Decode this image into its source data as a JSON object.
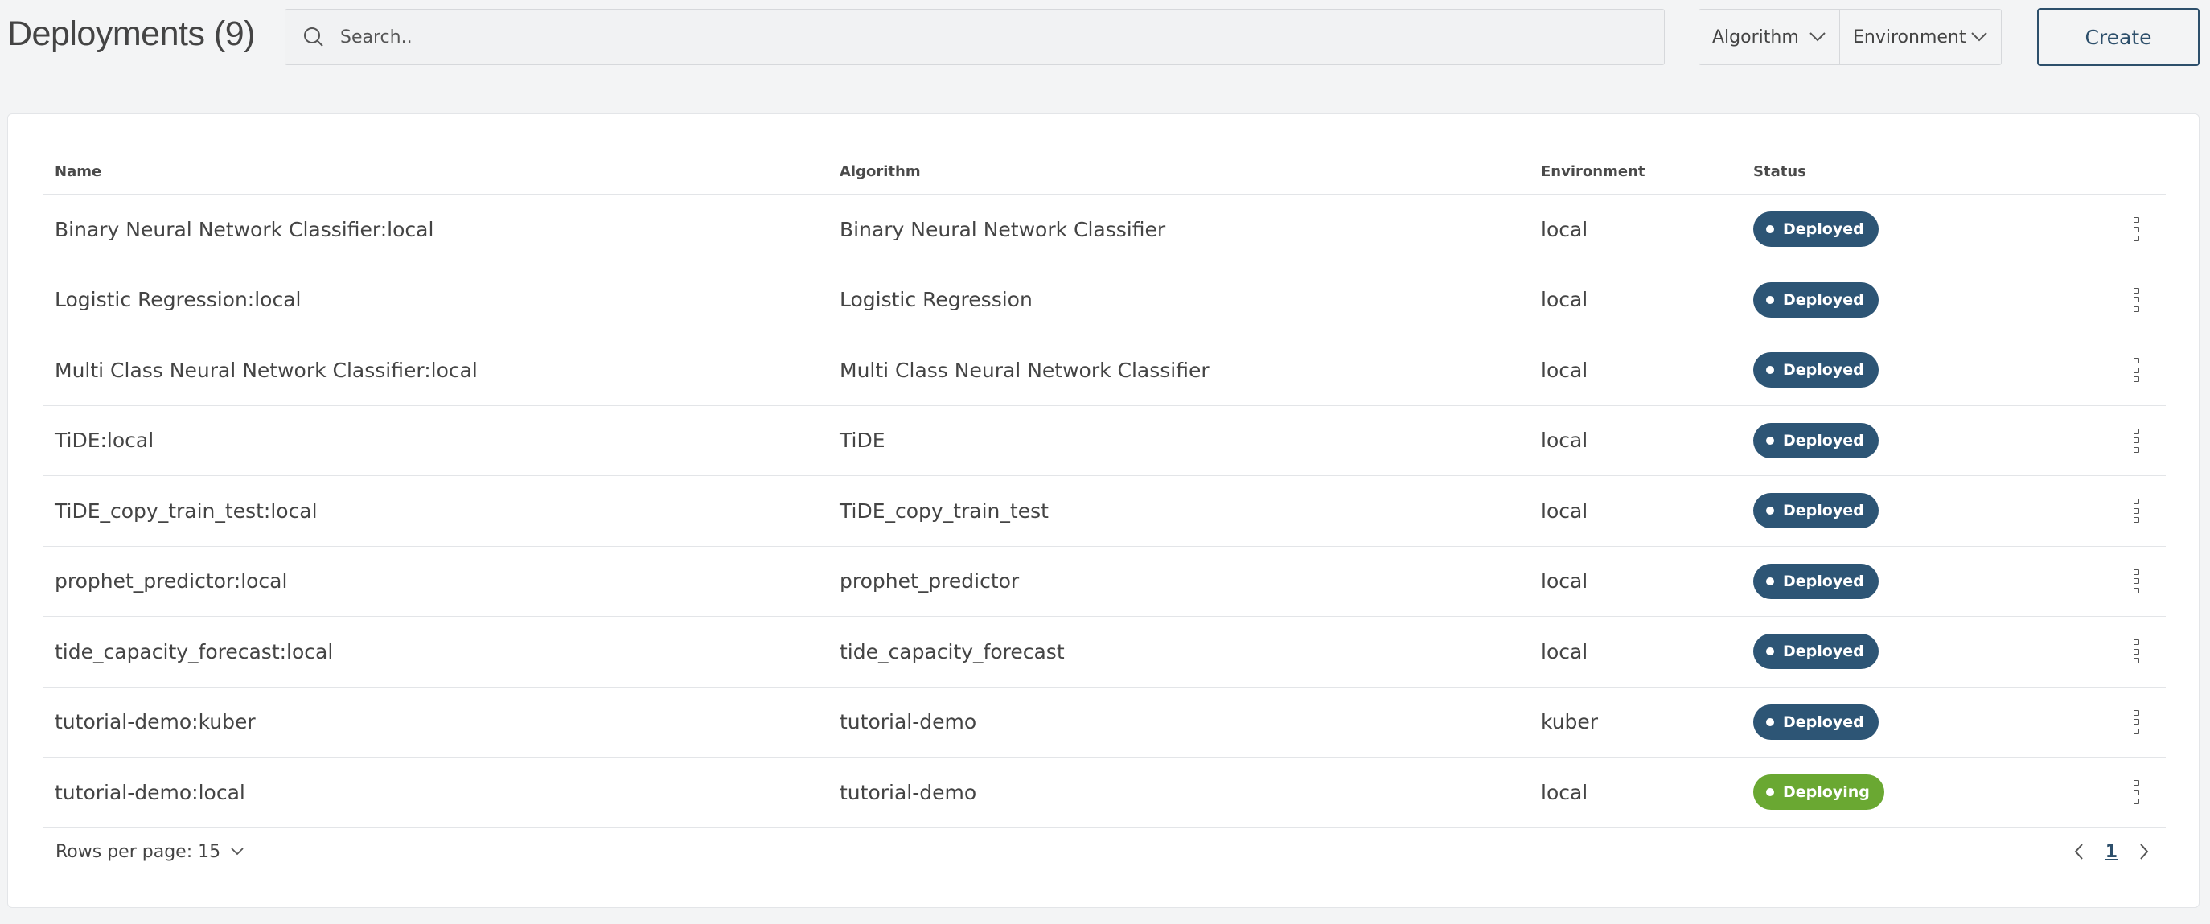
{
  "header": {
    "title": "Deployments (9)",
    "search_placeholder": "Search..",
    "filters": [
      {
        "label": "Algorithm",
        "icon": "chevron-down-icon"
      },
      {
        "label": "Environment",
        "icon": "chevron-down-icon"
      }
    ],
    "create_label": "Create"
  },
  "table": {
    "columns": [
      "Name",
      "Algorithm",
      "Environment",
      "Status"
    ],
    "rows": [
      {
        "name": "Binary Neural Network Classifier:local",
        "algorithm": "Binary Neural Network Classifier",
        "environment": "local",
        "status": "Deployed"
      },
      {
        "name": "Logistic Regression:local",
        "algorithm": "Logistic Regression",
        "environment": "local",
        "status": "Deployed"
      },
      {
        "name": "Multi Class Neural Network Classifier:local",
        "algorithm": "Multi Class Neural Network Classifier",
        "environment": "local",
        "status": "Deployed"
      },
      {
        "name": "TiDE:local",
        "algorithm": "TiDE",
        "environment": "local",
        "status": "Deployed"
      },
      {
        "name": "TiDE_copy_train_test:local",
        "algorithm": "TiDE_copy_train_test",
        "environment": "local",
        "status": "Deployed"
      },
      {
        "name": "prophet_predictor:local",
        "algorithm": "prophet_predictor",
        "environment": "local",
        "status": "Deployed"
      },
      {
        "name": "tide_capacity_forecast:local",
        "algorithm": "tide_capacity_forecast",
        "environment": "local",
        "status": "Deployed"
      },
      {
        "name": "tutorial-demo:kuber",
        "algorithm": "tutorial-demo",
        "environment": "kuber",
        "status": "Deployed"
      },
      {
        "name": "tutorial-demo:local",
        "algorithm": "tutorial-demo",
        "environment": "local",
        "status": "Deploying"
      }
    ]
  },
  "footer": {
    "rows_per_page_label": "Rows per page: 15",
    "current_page": "1"
  },
  "colors": {
    "deployed": "#2d5575",
    "deploying": "#6aa832",
    "accent": "#2d4f6b"
  }
}
